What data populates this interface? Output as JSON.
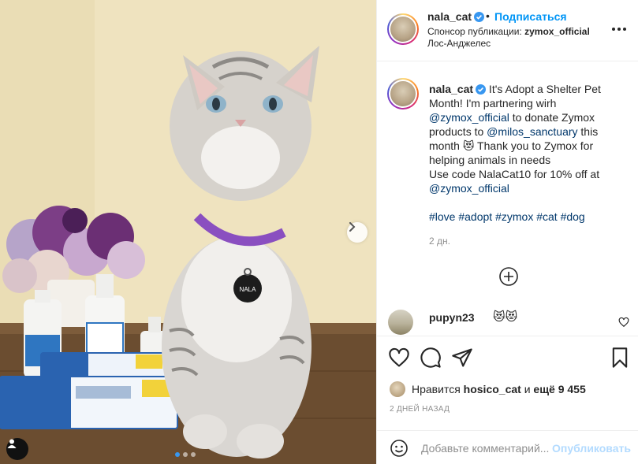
{
  "post": {
    "author": "nala_cat",
    "subscribe_label": "Подписаться",
    "sponsor_prefix": "Спонсор публикации:",
    "sponsor_name": "zymox_official",
    "location": "Лос-Анджелес",
    "photo_tag_text": "NALA",
    "carousel_dots": 3,
    "carousel_active_index": 0
  },
  "caption": {
    "user": "nala_cat",
    "text_1": " It's Adopt a Shelter Pet Month! I'm partnering wirh ",
    "mention_1": "@zymox_official",
    "text_2": " to donate Zymox products to ",
    "mention_2": "@milos_sanctuary",
    "text_3": " this month ",
    "emoji_1": "😻",
    "text_4": " Thank you to Zymox for helping animals in needs",
    "text_5": "Use code NalaCat10 for 10% off at ",
    "mention_3": "@zymox_official",
    "hashtags": [
      "#love",
      "#adopt",
      "#zymox",
      "#cat",
      "#dog"
    ],
    "time": "2 дн."
  },
  "comment": {
    "user": "pupyn23",
    "text": "😻😻"
  },
  "likes": {
    "prefix": "Нравится",
    "user": "hosico_cat",
    "middle": "и",
    "more": "ещё 9 455"
  },
  "date": "2 ДНЕЙ НАЗАД",
  "add_comment": {
    "placeholder": "Добавьте комментарий...",
    "publish_label": "Опубликовать"
  },
  "icons": {
    "verified": "verified-badge-icon",
    "more": "more-horizontal-icon",
    "load_more": "plus-circle-icon",
    "heart": "heart-icon",
    "comment": "comment-icon",
    "share": "direct-share-icon",
    "save": "bookmark-icon",
    "emoji": "smiley-icon",
    "next": "chevron-right-icon",
    "user_tags": "user-tags-icon"
  },
  "colors": {
    "link": "#00376b",
    "accent": "#0095f6",
    "publish_disabled": "#b3dbff",
    "muted": "#8e8e8e"
  }
}
